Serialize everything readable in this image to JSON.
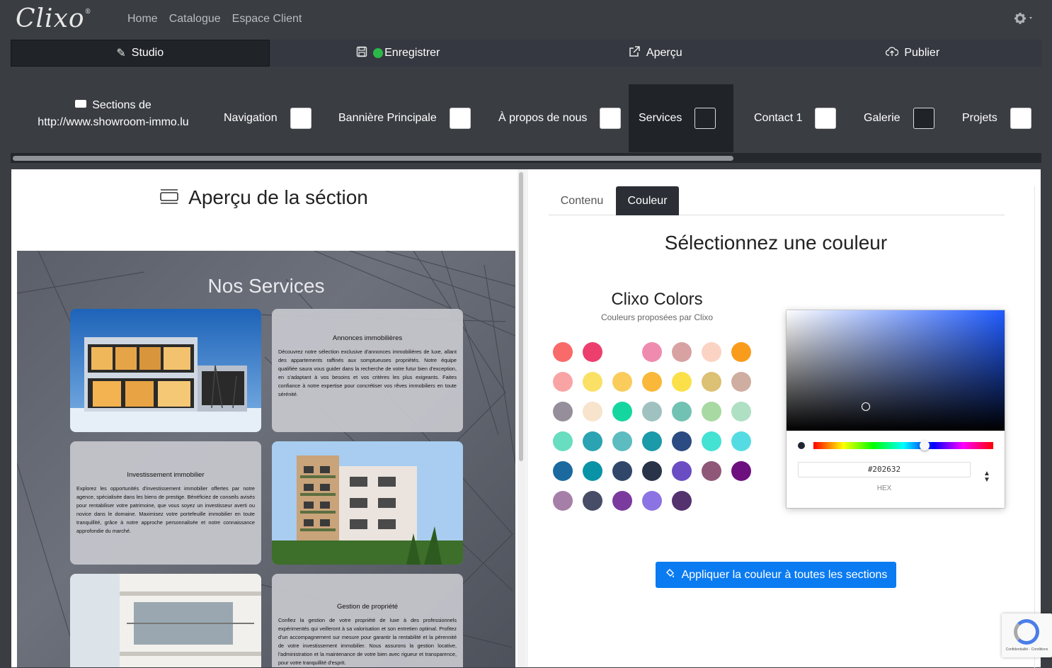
{
  "app": {
    "brand": "Clixo",
    "nav": [
      "Home",
      "Catalogue",
      "Espace Client"
    ]
  },
  "toolbar": {
    "studio": "Studio",
    "save": "Enregistrer",
    "preview": "Aperçu",
    "publish": "Publier"
  },
  "sections": {
    "title_line1": "Sections de",
    "title_line2": "http://www.showroom-immo.lu",
    "items": [
      "Navigation",
      "Bannière Principale",
      "À propos de nous",
      "Services",
      "Contact 1",
      "Galerie",
      "Projets"
    ],
    "active": "Services"
  },
  "preview": {
    "title": "Aperçu de la séction",
    "heading": "Nos Services",
    "cards": [
      {
        "title": "Annonces immobilières",
        "text": "Découvrez notre sélection exclusive d'annonces immobilières de luxe, allant des appartements raffinés aux somptueuses propriétés. Notre équipe qualifiée saura vous guider dans la recherche de votre futur bien d'exception, en s'adaptant à vos besoins et vos critères les plus exigeants. Faites confiance à notre expertise pour concrétiser vos rêves immobiliers en toute sérénité."
      },
      {
        "title": "Investissement immobilier",
        "text": "Explorez les opportunités d'investissement immobilier offertes par notre agence, spécialisée dans les biens de prestige. Bénéficiez de conseils avisés pour rentabiliser votre patrimoine, que vous soyez un investisseur averti ou novice dans le domaine. Maximisez votre portefeuille immobilier en toute tranquillité, grâce à notre approche personnalisée et notre connaissance approfondie du marché."
      },
      {
        "title": "Gestion de propriété",
        "text": "Confiez la gestion de votre propriété de luxe à des professionnels expérimentés qui veilleront à sa valorisation et son entretien optimal. Profitez d'un accompagnement sur mesure pour garantir la rentabilité et la pérennité de votre investissement immobilier. Nous assurons la gestion locative, l'administration et la maintenance de votre bien avec rigueur et transparence, pour votre tranquillité d'esprit."
      }
    ]
  },
  "panel": {
    "tabs": [
      "Contenu",
      "Couleur"
    ],
    "active_tab": "Couleur",
    "title": "Sélectionnez une couleur",
    "palette_title": "Clixo Colors",
    "palette_subtitle": "Couleurs proposées par Clixo",
    "swatches": [
      [
        "#f96a6a",
        "#ec3f6e",
        "",
        "#f08bb0",
        "#d9a2a2",
        "#fbd3c5",
        "#f99c1c"
      ],
      [
        "#f9a4a4",
        "#fbe066",
        "#f9cc5c",
        "#f9b83a",
        "#fbe04a",
        "#dcc073",
        "#cfada0"
      ],
      [
        "#968e9a",
        "#f8e3cc",
        "#16d6a0",
        "#9fc2c0",
        "#72c2b3",
        "#a9d9a3",
        "#afe0c4"
      ],
      [
        "#68ddc0",
        "#2ba3b2",
        "#5cbcc0",
        "#1b9aaa",
        "#2c4b82",
        "#44e2d2",
        "#55dce2"
      ],
      [
        "#1a6aa0",
        "#0a93a7",
        "#30476a",
        "#293448",
        "#6a4dc2",
        "#8f5878",
        "#6e0f7f"
      ],
      [
        "#a67fa8",
        "#474d66",
        "#7a3a9e",
        "#8c73e3",
        "#54326e"
      ]
    ],
    "hex_value": "#202632",
    "hex_label": "HEX",
    "apply_label": "Appliquer la couleur à toutes les sections"
  },
  "recaptcha": {
    "text": "Confidentialité - Conditions"
  }
}
